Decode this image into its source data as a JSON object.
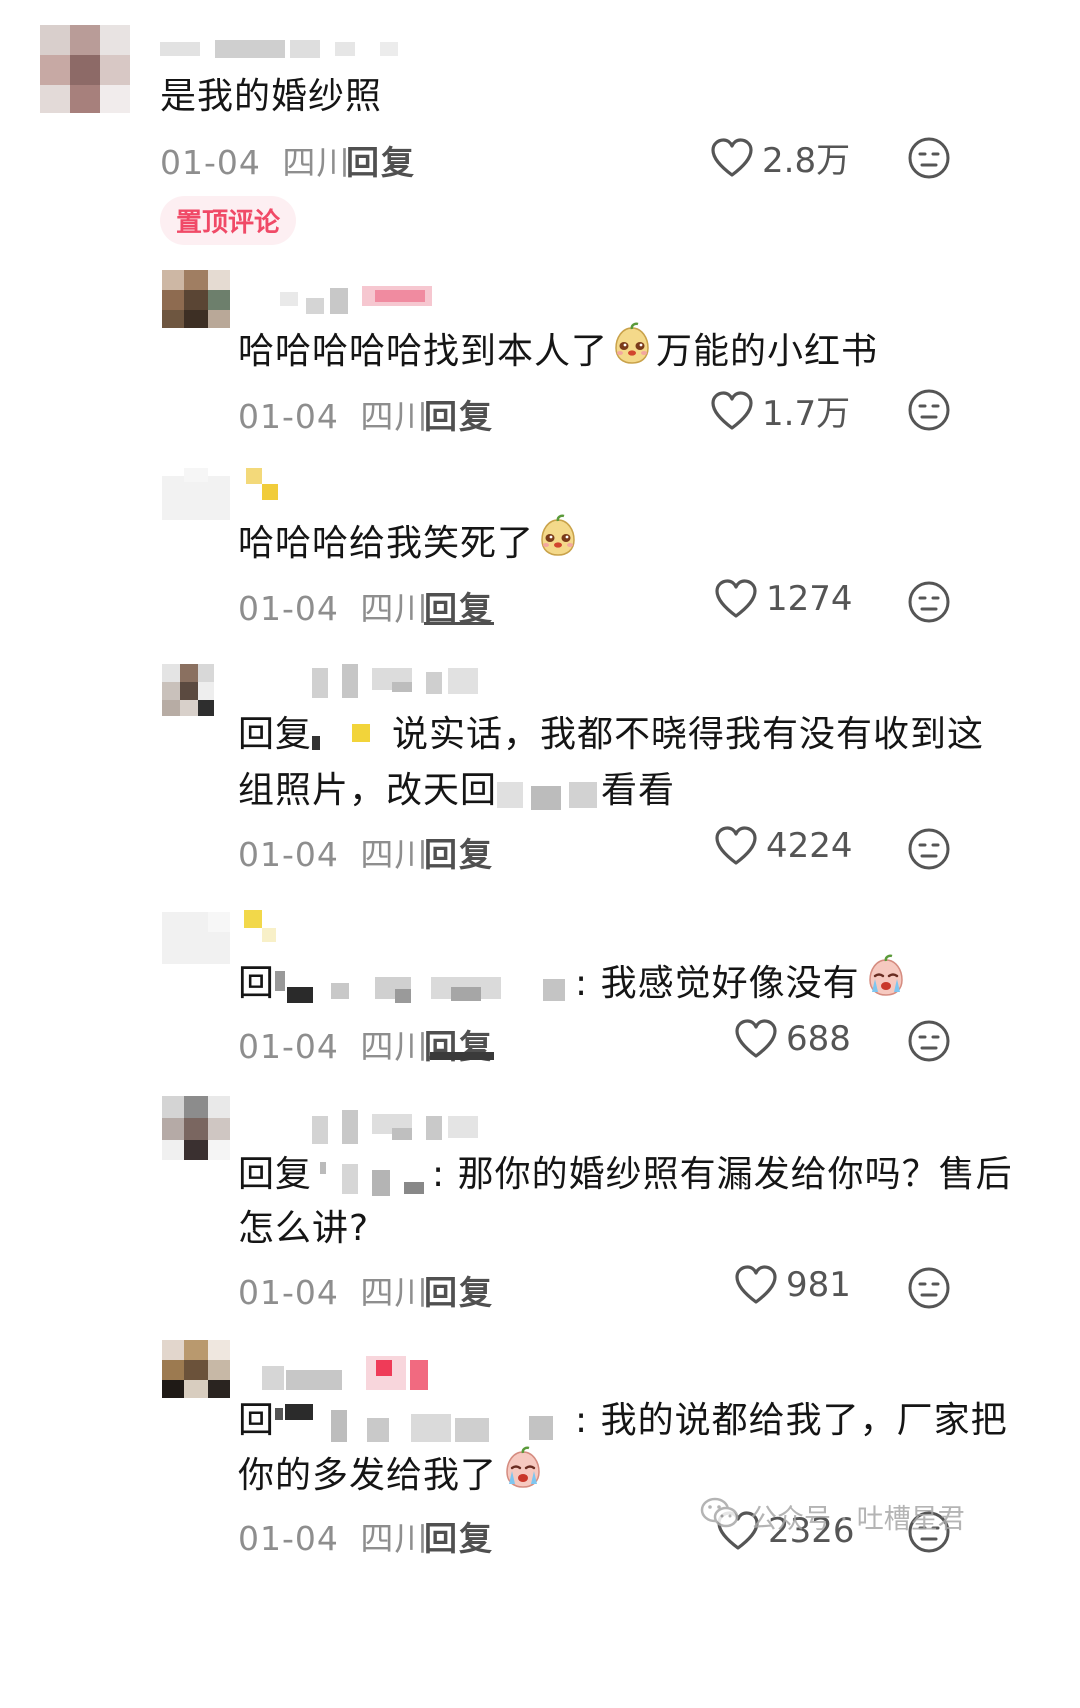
{
  "colors": {
    "pin_bg": "#fdeff2",
    "pin_text": "#f04a67",
    "meta": "#8e8e8e",
    "text": "#151515"
  },
  "comments": [
    {
      "text": "是我的婚纱照",
      "date": "01-04",
      "location": "四川",
      "reply_label": "回复",
      "likes": "2.8万",
      "pin_label": "置顶评论"
    },
    {
      "text_before": "哈哈哈哈哈找到本人了",
      "emoji": "pear-face-emoji",
      "text_after": "万能的小红书",
      "date": "01-04",
      "location": "四川",
      "reply_label": "回复",
      "likes": "1.7万"
    },
    {
      "text_before": "哈哈哈给我笑死了",
      "emoji": "pear-face-emoji",
      "date": "01-04",
      "location": "四川",
      "reply_label": "回复",
      "likes": "1274"
    },
    {
      "line1_prefix": "回复",
      "line1_rest": "说实话，我都不晓得我有没有收到这",
      "line2_start": "组照片，改天回",
      "line2_end": "看看",
      "date": "01-04",
      "location": "四川",
      "reply_label": "回复",
      "likes": "4224"
    },
    {
      "line1_prefix": "回",
      "line1_rest": ": 我感觉好像没有",
      "emoji": "crying-pear-emoji",
      "date": "01-04",
      "location": "四川",
      "reply_label": "回复",
      "likes": "688"
    },
    {
      "line1_prefix": "回复",
      "line1_rest": ": 那你的婚纱照有漏发给你吗？售后",
      "line2": "怎么讲?",
      "date": "01-04",
      "location": "四川",
      "reply_label": "回复",
      "likes": "981"
    },
    {
      "line1_prefix": "回",
      "line1_rest": ": 我的说都给我了，厂家把",
      "line2": "你的多发给我了",
      "emoji": "crying-pear-emoji",
      "date": "01-04",
      "location": "四川",
      "reply_label": "回复",
      "likes": "2326"
    }
  ],
  "watermark": {
    "text": "公众号 · 吐槽星君",
    "icon": "wechat-icon"
  }
}
